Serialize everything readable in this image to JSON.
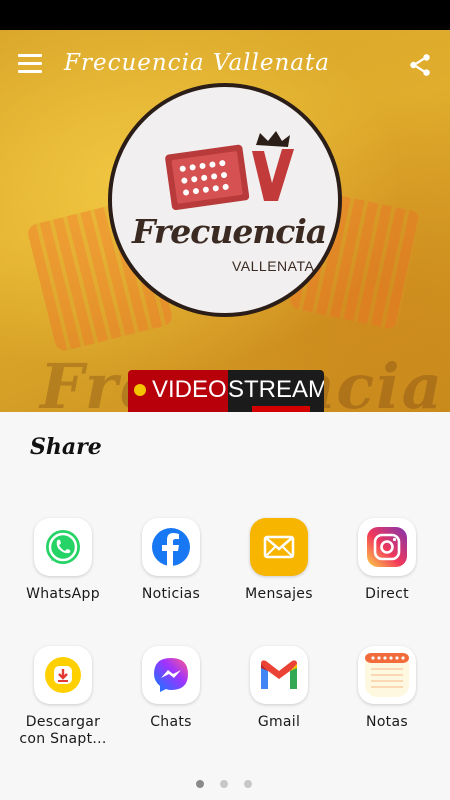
{
  "app": {
    "title": "Frecuencia Vallenata",
    "logo_main": "Frecuencia",
    "logo_sub": "VALLENATA",
    "background_watermark": "Frecuencia"
  },
  "badge": {
    "video": "VIDEO",
    "stream": "STREAM"
  },
  "share_sheet": {
    "title": "Share",
    "apps": [
      {
        "label": "WhatsApp",
        "icon": "whatsapp-icon",
        "color": "#25D366"
      },
      {
        "label": "Noticias",
        "icon": "facebook-icon",
        "color": "#1877F2"
      },
      {
        "label": "Mensajes",
        "icon": "messages-icon",
        "color": "#F7B500"
      },
      {
        "label": "Direct",
        "icon": "instagram-icon",
        "color": "#E1306C"
      },
      {
        "label_line1": "Descargar",
        "label_line2": "con Snapt...",
        "icon": "snaptube-download-icon",
        "color": "#FFD000"
      },
      {
        "label": "Chats",
        "icon": "messenger-icon",
        "color": "#8A3FFC"
      },
      {
        "label": "Gmail",
        "icon": "gmail-icon",
        "color": "#EA4335"
      },
      {
        "label": "Notas",
        "icon": "notes-icon",
        "color": "#F26B3A"
      }
    ],
    "pager": {
      "pages": 3,
      "active": 0
    }
  },
  "colors": {
    "background": "#D9A52A",
    "sheet": "#F7F7F7",
    "badge_red": "#B8000A",
    "badge_dark": "#1B1B1B"
  }
}
